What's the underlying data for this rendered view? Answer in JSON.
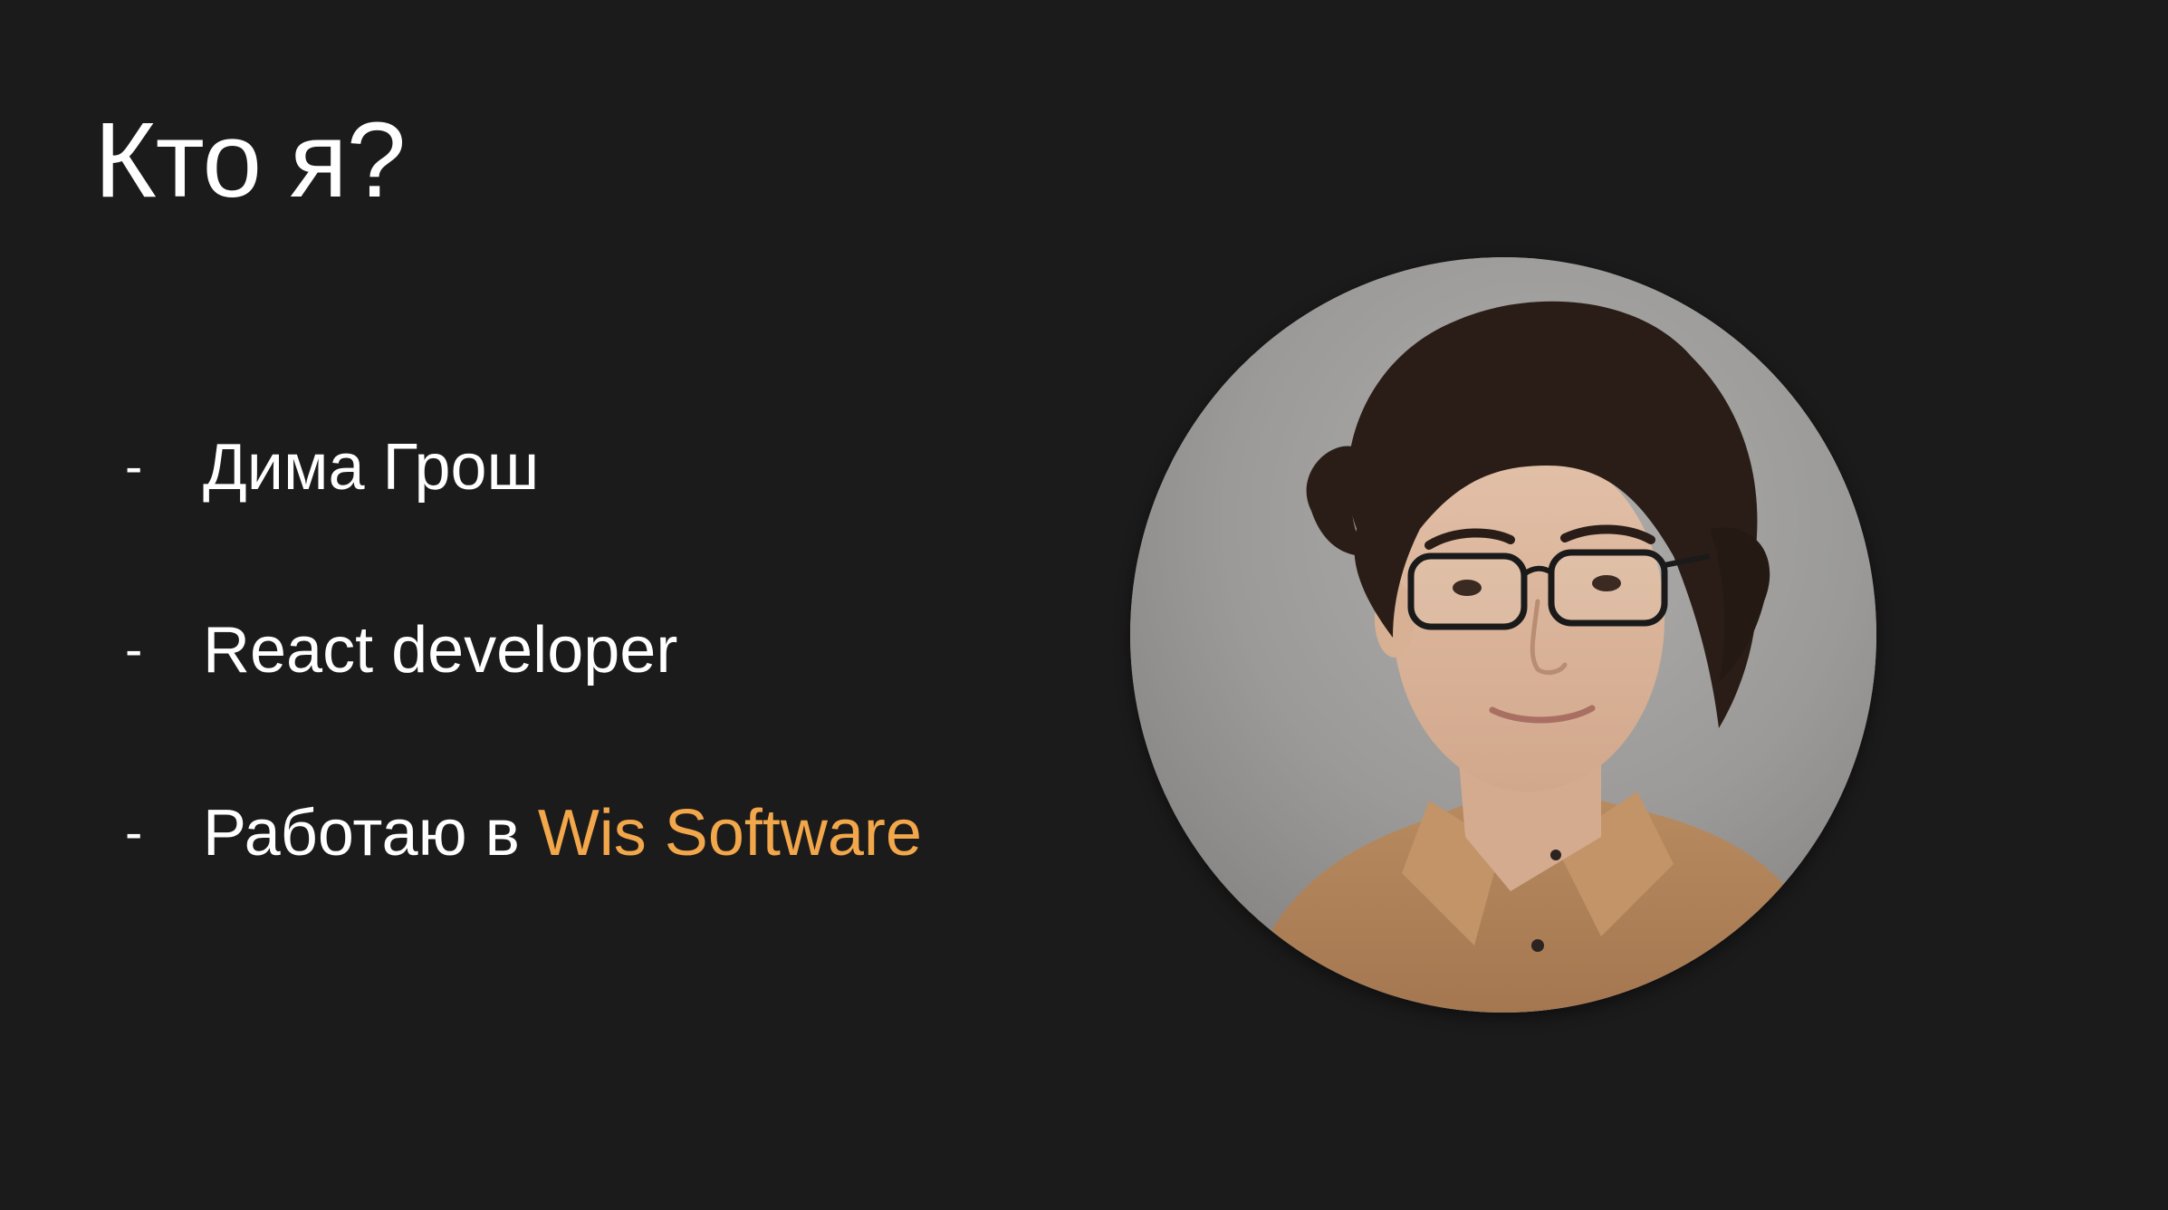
{
  "slide": {
    "title": "Кто я?",
    "bullets": [
      {
        "dash": "-",
        "text": "Дима Грош",
        "accent": ""
      },
      {
        "dash": "-",
        "text": "React developer",
        "accent": ""
      },
      {
        "dash": "-",
        "text": "Работаю в ",
        "accent": "Wis Software"
      }
    ],
    "accent_color": "#f2a74b",
    "background_color": "#1c1b1b"
  },
  "photo": {
    "alt": "portrait-photo"
  }
}
